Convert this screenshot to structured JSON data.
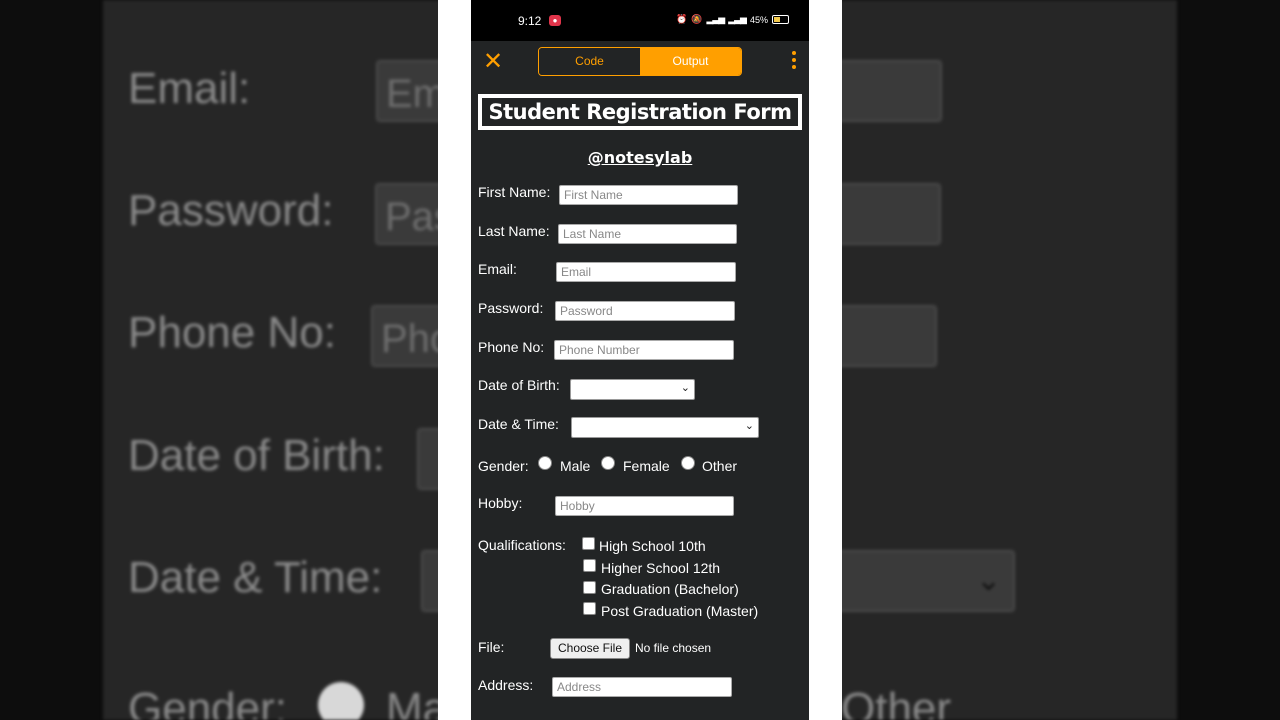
{
  "background": {
    "labels": [
      "Email:",
      "Password:",
      "Phone No:",
      "Date of Birth:",
      "Date & Time:",
      "Gender:"
    ],
    "input_fragments": [
      "Em",
      "Pas",
      "Pho"
    ],
    "right_fragments": [
      "Ma",
      "Other"
    ]
  },
  "status_bar": {
    "time": "9:12",
    "battery": "45%"
  },
  "toolbar": {
    "tab_code": "Code",
    "tab_output": "Output",
    "active_tab": "Output"
  },
  "form": {
    "title": "Student Registration Form",
    "handle": "@notesylab",
    "fields": {
      "first_name": {
        "label": "First Name:",
        "placeholder": "First Name"
      },
      "last_name": {
        "label": "Last Name:",
        "placeholder": "Last Name"
      },
      "email": {
        "label": "Email:",
        "placeholder": "Email"
      },
      "password": {
        "label": "Password:",
        "placeholder": "Password"
      },
      "phone": {
        "label": "Phone No:",
        "placeholder": "Phone Number"
      },
      "dob": {
        "label": "Date of Birth:"
      },
      "datetime": {
        "label": "Date & Time:"
      },
      "hobby": {
        "label": "Hobby:",
        "placeholder": "Hobby"
      },
      "address": {
        "label": "Address:",
        "placeholder": "Address"
      }
    },
    "gender": {
      "label": "Gender:",
      "options": [
        "Male",
        "Female",
        "Other"
      ]
    },
    "qualifications": {
      "label": "Qualifications:",
      "options": [
        "High School 10th",
        "Higher School 12th",
        "Graduation (Bachelor)",
        "Post Graduation (Master)"
      ]
    },
    "file": {
      "label": "File:",
      "button": "Choose File",
      "status": "No file chosen"
    }
  }
}
